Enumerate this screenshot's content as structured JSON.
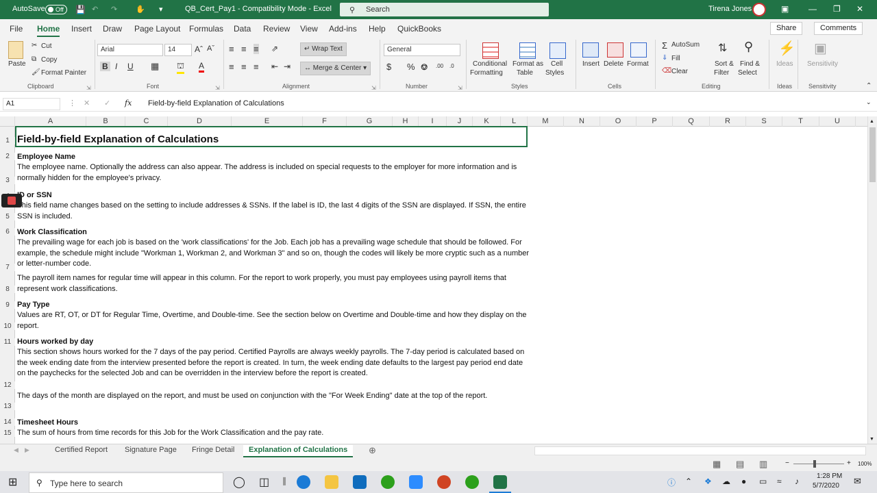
{
  "window": {
    "autosave_label": "AutoSave",
    "autosave_state": "Off",
    "title": "QB_Cert_Pay1  -  Compatibility Mode  -  Excel",
    "search_placeholder": "Search",
    "user_name": "Tirena Jones"
  },
  "menu": {
    "items": [
      "File",
      "Home",
      "Insert",
      "Draw",
      "Page Layout",
      "Formulas",
      "Data",
      "Review",
      "View",
      "Add-ins",
      "Help",
      "QuickBooks"
    ],
    "active": "Home",
    "share": "Share",
    "comments": "Comments"
  },
  "ribbon": {
    "clipboard": {
      "paste": "Paste",
      "cut": "Cut",
      "copy": "Copy",
      "format_painter": "Format Painter",
      "group": "Clipboard"
    },
    "font": {
      "name": "Arial",
      "size": "14",
      "group": "Font"
    },
    "alignment": {
      "wrap_text": "Wrap Text",
      "merge_center": "Merge & Center",
      "group": "Alignment"
    },
    "number": {
      "format": "General",
      "group": "Number"
    },
    "styles": {
      "conditional": "Conditional",
      "formatting": "Formatting",
      "format_as": "Format as",
      "table": "Table",
      "cell": "Cell",
      "cell_styles": "Styles",
      "group": "Styles"
    },
    "cells": {
      "insert": "Insert",
      "delete": "Delete",
      "format": "Format",
      "group": "Cells"
    },
    "editing": {
      "autosum": "AutoSum",
      "fill": "Fill",
      "clear": "Clear",
      "sort": "Sort &",
      "filter": "Filter",
      "find": "Find &",
      "select": "Select",
      "group": "Editing"
    },
    "ideas": {
      "label": "Ideas",
      "group": "Ideas"
    },
    "sensitivity": {
      "label": "Sensitivity",
      "group": "Sensitivity"
    }
  },
  "formula_bar": {
    "name_box": "A1",
    "fx": "fx",
    "content": "Field-by-field Explanation of Calculations"
  },
  "columns": [
    "A",
    "B",
    "C",
    "D",
    "E",
    "F",
    "G",
    "H",
    "I",
    "J",
    "K",
    "L",
    "M",
    "N",
    "O",
    "P",
    "Q",
    "R",
    "S",
    "T",
    "U"
  ],
  "rows": [
    "1",
    "2",
    "3",
    "4",
    "5",
    "6",
    "7",
    "8",
    "9",
    "10",
    "11",
    "12",
    "13",
    "14",
    "15"
  ],
  "cells": {
    "a1": "Field-by-field Explanation of Calculations",
    "a2": "Employee Name",
    "a3": "The employee name. Optionally the address can also appear. The address is included on special requests to the employer for more information and is normally hidden for the employee's privacy.",
    "a4": "ID or SSN",
    "a5": "This field name changes based on the setting to include addresses & SSNs. If the label is ID, the last 4 digits of the SSN are displayed. If SSN, the entire SSN is included.",
    "a6": "Work Classification",
    "a7": "The prevailing wage for each job is based on the 'work classifications' for the Job. Each job has a prevailing wage schedule that should be followed. For example, the schedule might include \"Workman 1, Workman 2, and Workman 3\" and so on, though the codes will likely be more cryptic such as a number or letter-number code.",
    "a8": "The payroll item names for regular time will appear in this column. For the report to work properly, you must pay employees using payroll items that represent work classifications.",
    "a9": "Pay Type",
    "a10": "Values are RT, OT, or DT for Regular Time, Overtime, and Double-time. See the section below on Overtime and Double-time and how they display on the report.",
    "a11": "Hours worked by day",
    "a12": "This section shows hours worked for the 7 days of the pay period. Certified Payrolls are always weekly payrolls. The 7-day period is calculated based on the week ending date from the interview presented before the report is created. In turn, the week ending date defaults to the largest pay period end date on the paychecks for the selected Job and can be overridden in the interview before the report is created.",
    "a13": "The days of the month are displayed on the report, and must be used on conjunction with the \"For Week Ending\" date at the top of the report.",
    "a14": "Timesheet Hours",
    "a15": "The sum of hours from time records for this Job for the Work Classification and the pay rate."
  },
  "sheets": [
    "Certified Report",
    "Signature Page",
    "Fringe Detail",
    "Explanation of Calculations"
  ],
  "active_sheet": "Explanation of Calculations",
  "status": {
    "zoom": "100%"
  },
  "taskbar": {
    "search_placeholder": "Type here to search",
    "time": "1:28 PM",
    "date": "5/7/2020"
  },
  "colors": {
    "excel_green": "#217346",
    "recording": "#e04848"
  }
}
